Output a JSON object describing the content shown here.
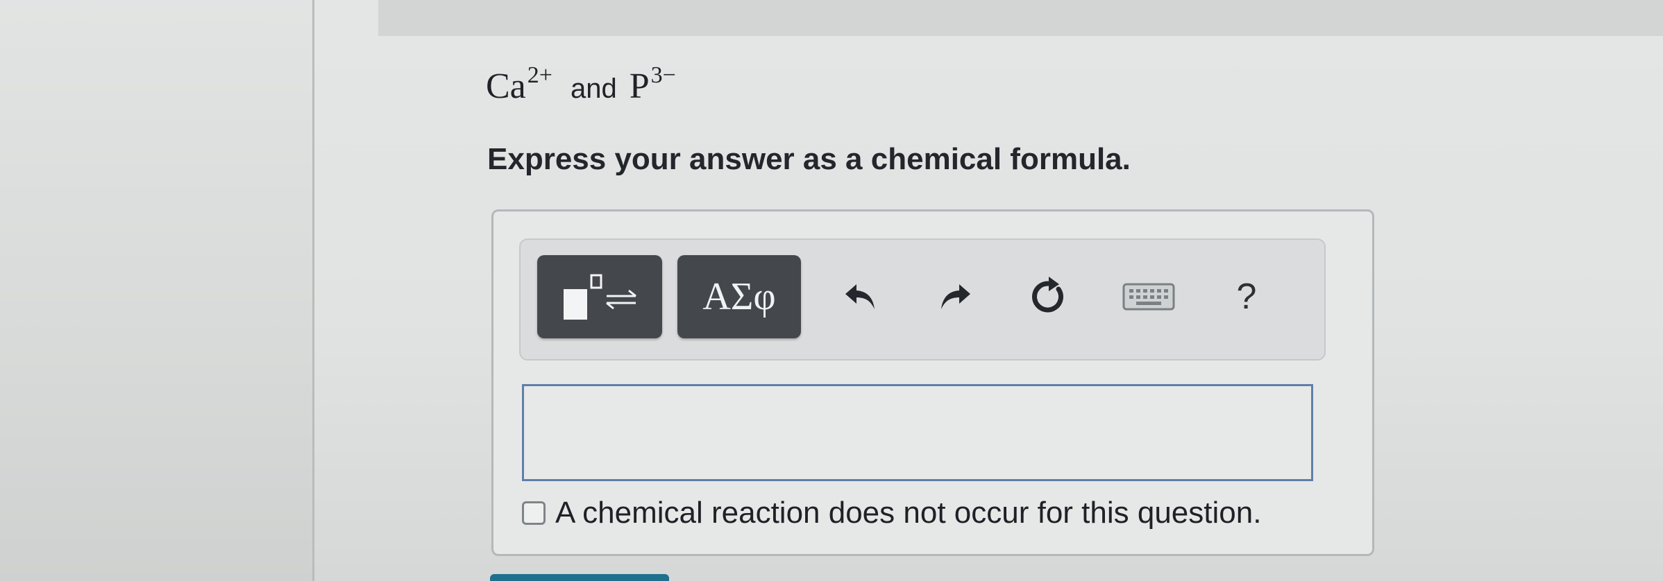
{
  "question": {
    "cation": {
      "symbol": "Ca",
      "charge": "2+"
    },
    "conjunction": "and",
    "anion": {
      "symbol": "P",
      "charge": "3−"
    },
    "instruction": "Express your answer as a chemical formula."
  },
  "toolbar": {
    "greek_label": "ΑΣφ",
    "help_label": "?",
    "icons": [
      "templates-icon",
      "undo-icon",
      "redo-icon",
      "reset-icon",
      "keyboard-icon",
      "help-icon"
    ]
  },
  "answer": {
    "value": "",
    "placeholder": ""
  },
  "no_reaction": {
    "label": "A chemical reaction does not occur for this question.",
    "checked": false
  },
  "colors": {
    "toolbar_button": "#44484c",
    "input_border": "#5f7fa8",
    "submit": "#1f6f8e"
  }
}
